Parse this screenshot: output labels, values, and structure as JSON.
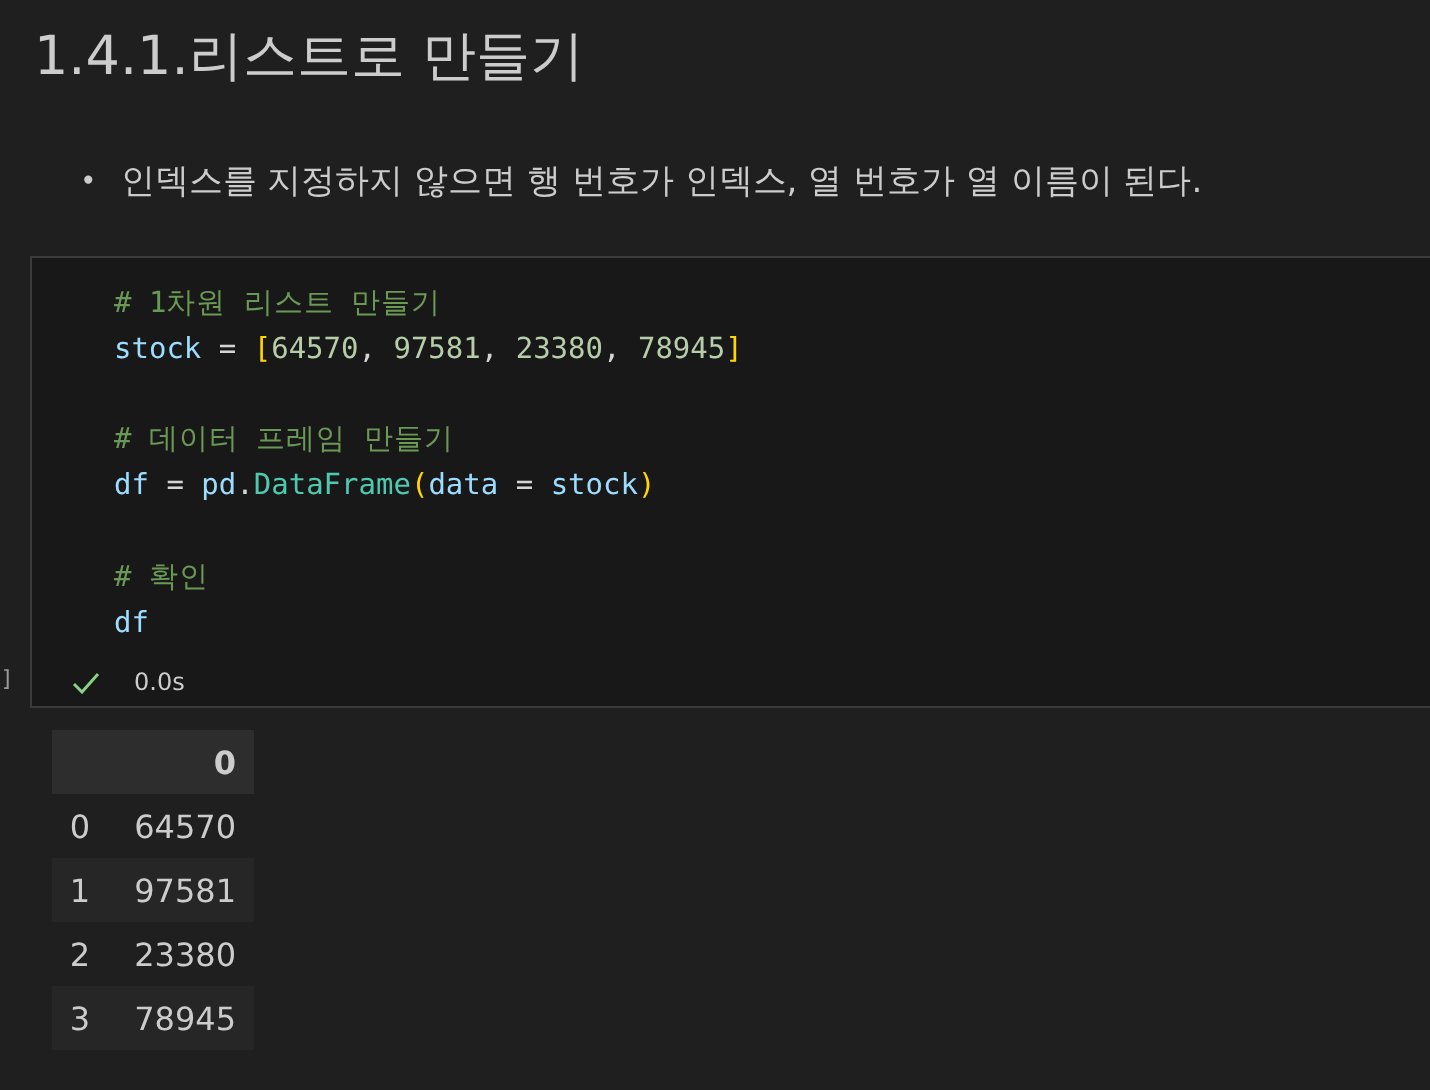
{
  "heading": "1.4.1.리스트로 만들기",
  "bullets": [
    {
      "marker": "•",
      "text": "인덱스를 지정하지 않으면 행 번호가 인덱스, 열 번호가 열 이름이 된다."
    }
  ],
  "code_cell": {
    "execution_count": "]",
    "lines": [
      {
        "blank_before": false,
        "tokens": [
          {
            "kind": "comment",
            "text": "# 1차원 리스트 만들기"
          }
        ]
      },
      {
        "blank_before": false,
        "tokens": [
          {
            "kind": "var",
            "text": "stock"
          },
          {
            "kind": "op",
            "text": " = "
          },
          {
            "kind": "bracket",
            "text": "["
          },
          {
            "kind": "num",
            "text": "64570"
          },
          {
            "kind": "op",
            "text": ", "
          },
          {
            "kind": "num",
            "text": "97581"
          },
          {
            "kind": "op",
            "text": ", "
          },
          {
            "kind": "num",
            "text": "23380"
          },
          {
            "kind": "op",
            "text": ", "
          },
          {
            "kind": "num",
            "text": "78945"
          },
          {
            "kind": "bracket",
            "text": "]"
          }
        ]
      },
      {
        "blank_before": true,
        "tokens": [
          {
            "kind": "comment",
            "text": "# 데이터 프레임 만들기"
          }
        ]
      },
      {
        "blank_before": false,
        "tokens": [
          {
            "kind": "var",
            "text": "df"
          },
          {
            "kind": "op",
            "text": " = "
          },
          {
            "kind": "var",
            "text": "pd"
          },
          {
            "kind": "op",
            "text": "."
          },
          {
            "kind": "func",
            "text": "DataFrame"
          },
          {
            "kind": "bracket",
            "text": "("
          },
          {
            "kind": "var",
            "text": "data"
          },
          {
            "kind": "op",
            "text": " = "
          },
          {
            "kind": "var",
            "text": "stock"
          },
          {
            "kind": "bracket",
            "text": ")"
          }
        ]
      },
      {
        "blank_before": true,
        "tokens": [
          {
            "kind": "comment",
            "text": "# 확인"
          }
        ]
      },
      {
        "blank_before": false,
        "tokens": [
          {
            "kind": "var",
            "text": "df"
          }
        ]
      }
    ],
    "status": {
      "success": true,
      "time": "0.0s"
    }
  },
  "output_table": {
    "columns": [
      "0"
    ],
    "rows": [
      {
        "index": "0",
        "value": "64570"
      },
      {
        "index": "1",
        "value": "97581"
      },
      {
        "index": "2",
        "value": "23380"
      },
      {
        "index": "3",
        "value": "78945"
      }
    ]
  }
}
